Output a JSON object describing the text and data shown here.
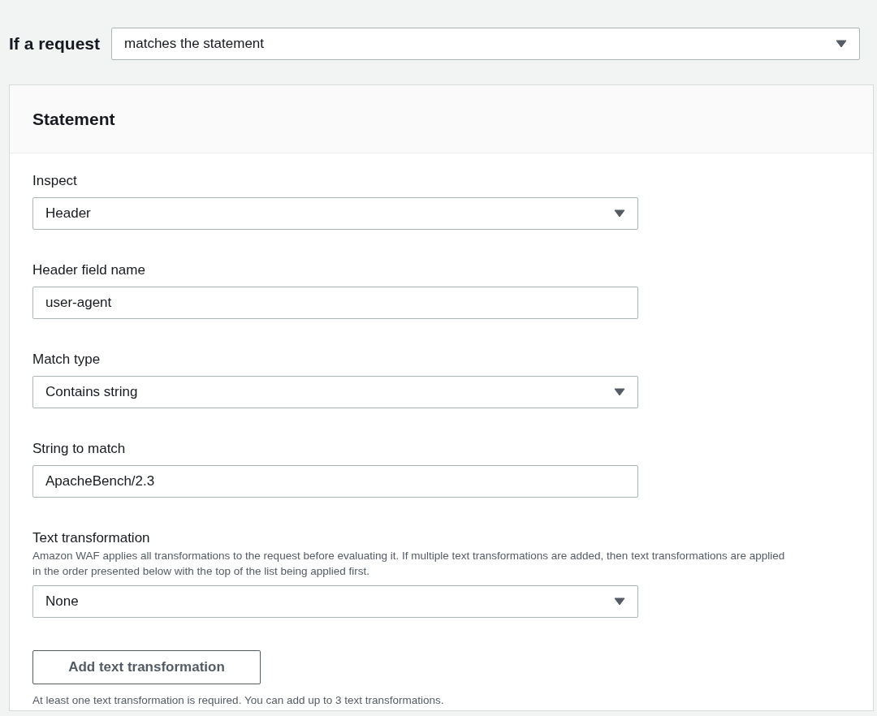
{
  "condition": {
    "label": "If a request",
    "value": "matches the statement"
  },
  "statement": {
    "title": "Statement",
    "fields": [
      {
        "kind": "select",
        "label": "Inspect",
        "value": "Header"
      },
      {
        "kind": "input",
        "label": "Header field name",
        "value": "user-agent"
      },
      {
        "kind": "select",
        "label": "Match type",
        "value": "Contains string"
      },
      {
        "kind": "input",
        "label": "String to match",
        "value": "ApacheBench/2.3"
      },
      {
        "kind": "select",
        "label": "Text transformation",
        "description": "Amazon WAF applies all transformations to the request before evaluating it. If multiple text transformations are added, then text transformations are applied in the order presented below with the top of the list being applied first.",
        "value": "None"
      }
    ],
    "add_button": "Add text transformation",
    "note": "At least one text transformation is required. You can add up to 3 text transformations."
  }
}
